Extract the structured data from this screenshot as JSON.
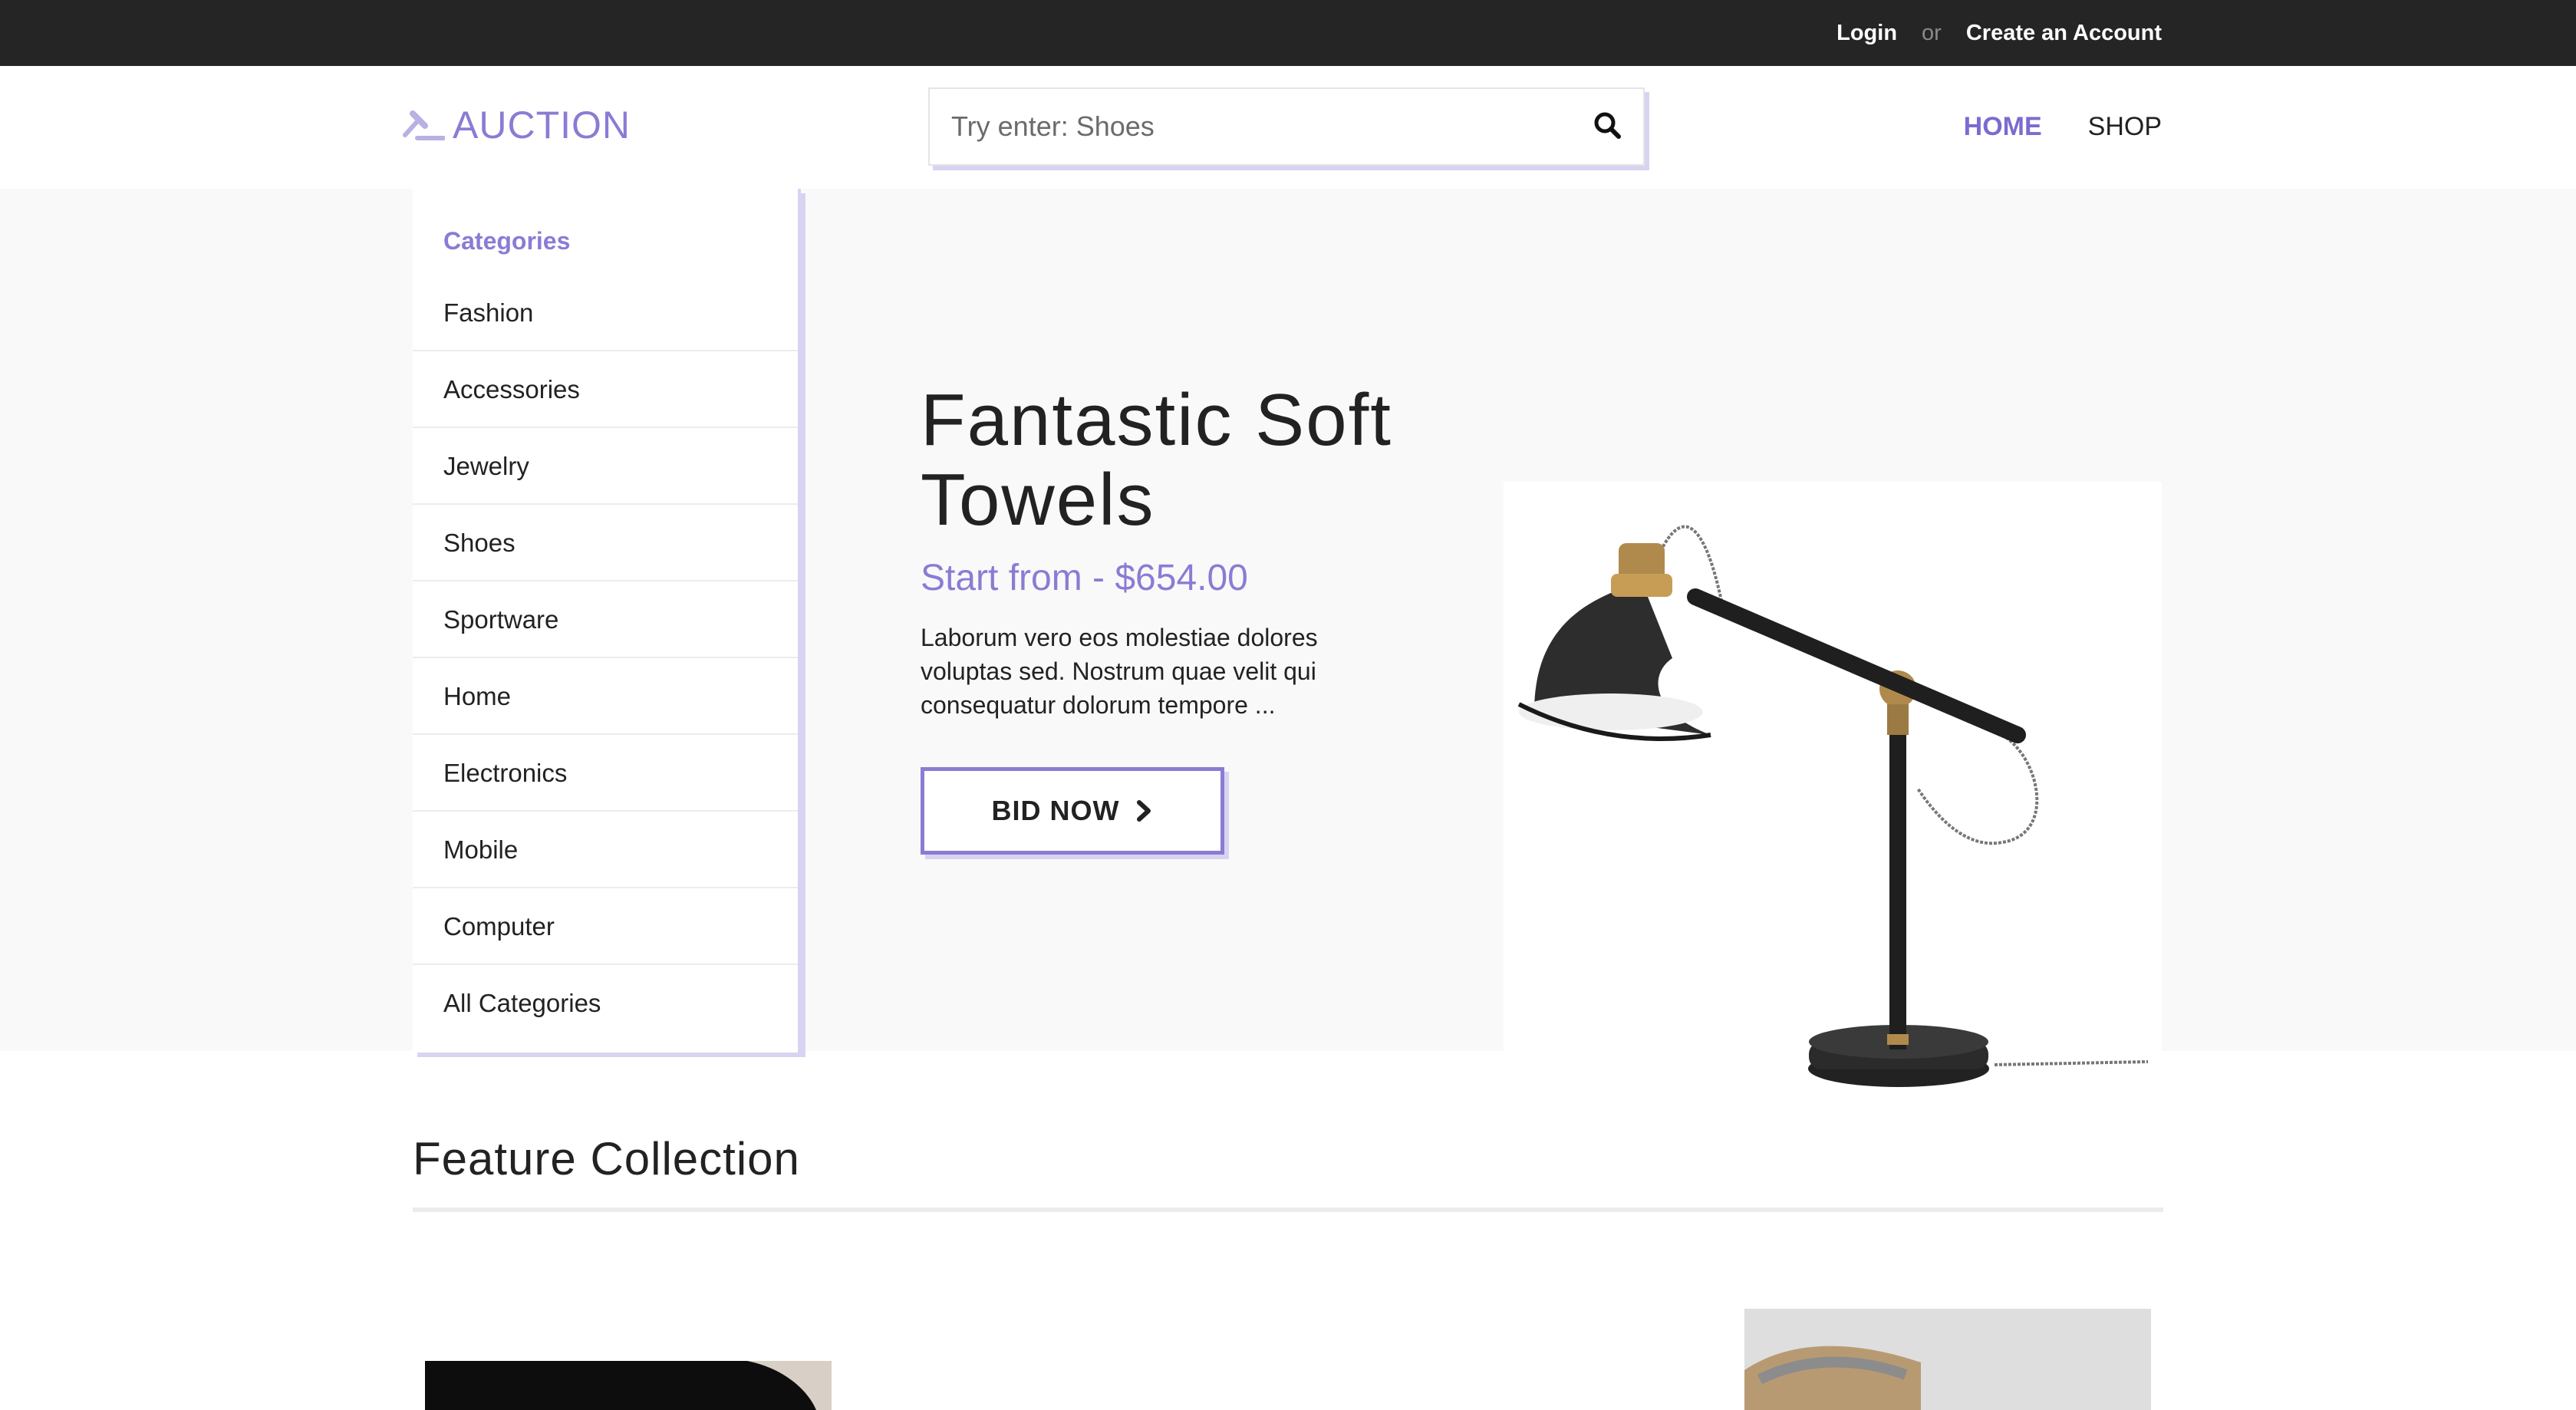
{
  "topbar": {
    "login": "Login",
    "or": "or",
    "create_account": "Create an Account"
  },
  "logo": {
    "text": "AUCTION"
  },
  "search": {
    "placeholder": "Try enter: Shoes"
  },
  "nav": {
    "home": "HOME",
    "shop": "SHOP"
  },
  "categories": {
    "title": "Categories",
    "items": [
      "Fashion",
      "Accessories",
      "Jewelry",
      "Shoes",
      "Sportware",
      "Home",
      "Electronics",
      "Mobile",
      "Computer",
      "All Categories"
    ]
  },
  "hero": {
    "title": "Fantastic Soft Towels",
    "price": "Start from - $654.00",
    "description": "Laborum vero eos molestiae dolores voluptas sed. Nostrum quae velit qui consequatur dolorum tempore ...",
    "bid_label": "BID NOW"
  },
  "feature": {
    "title": "Feature Collection"
  },
  "colors": {
    "accent": "#8c7bd4",
    "accent_shadow": "#d9d3f2",
    "topbar": "#252525"
  }
}
